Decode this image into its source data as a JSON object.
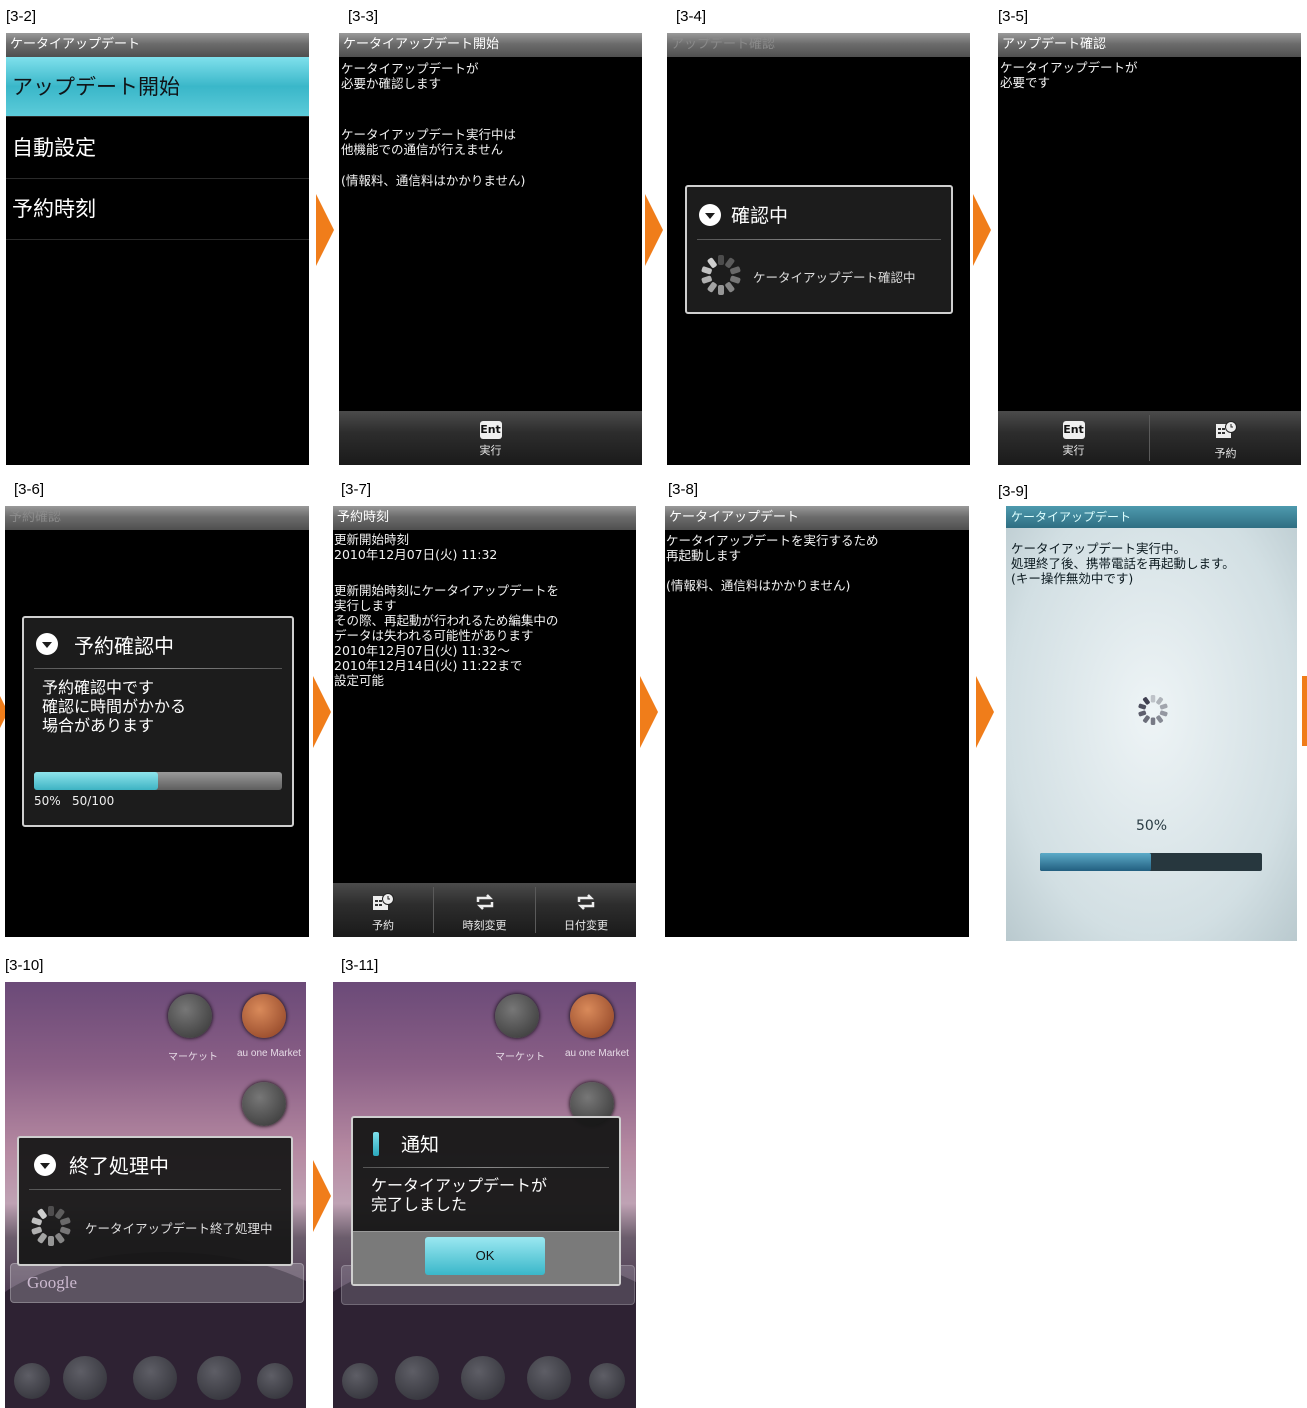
{
  "labels": {
    "s32": "[3-2]",
    "s33": "[3-3]",
    "s34": "[3-4]",
    "s35": "[3-5]",
    "s36": "[3-6]",
    "s37": "[3-7]",
    "s38": "[3-8]",
    "s39": "[3-9]",
    "s310": "[3-10]",
    "s311": "[3-11]"
  },
  "s32": {
    "title": "ケータイアップデート",
    "items": [
      "アップデート開始",
      "自動設定",
      "予約時刻"
    ]
  },
  "s33": {
    "title": "ケータイアップデート開始",
    "text1": "ケータイアップデートが\n必要か確認します",
    "text2": "ケータイアップデート実行中は\n他機能での通信が行えません",
    "text3": "(情報料、通信料はかかりません)",
    "btn_icon": "Ent",
    "btn": "実行"
  },
  "s34": {
    "title": "アップデート確認",
    "dialog_title": "確認中",
    "dialog_msg": "ケータイアップデート確認中"
  },
  "s35": {
    "title": "アップデート確認",
    "text": "ケータイアップデートが\n必要です",
    "btn_icon": "Ent",
    "btn1": "実行",
    "btn2": "予約"
  },
  "s36": {
    "title": "予約確認",
    "dialog_title": "予約確認中",
    "msg": "予約確認中です\n確認に時間がかかる\n場合があります",
    "progress": 0.5,
    "pct": "50%",
    "count": "50/100"
  },
  "s37": {
    "title": "予約時刻",
    "text1": "更新開始時刻\n2010年12月07日(火) 11:32",
    "text2": "更新開始時刻にケータイアップデートを\n実行します\nその際、再起動が行われるため編集中の\nデータは失われる可能性があります\n2010年12月07日(火) 11:32～\n2010年12月14日(火) 11:22まで\n設定可能",
    "btn1": "予約",
    "btn2": "時刻変更",
    "btn3": "日付変更"
  },
  "s38": {
    "title": "ケータイアップデート",
    "text1": "ケータイアップデートを実行するため\n再起動します",
    "text2": "(情報料、通信料はかかりません)"
  },
  "s39": {
    "title": "ケータイアップデート",
    "text": "ケータイアップデート実行中。\n処理終了後、携帯電話を再起動します。\n(キー操作無効中です)",
    "pct": "50%",
    "progress": 0.5
  },
  "s310": {
    "app1": "マーケット",
    "app2": "au one Market",
    "dialog_title": "終了処理中",
    "dialog_msg": "ケータイアップデート終了処理中",
    "search": "Google"
  },
  "s311": {
    "app1": "マーケット",
    "app2": "au one Market",
    "dialog_title": "通知",
    "dialog_msg": "ケータイアップデートが\n完了しました",
    "ok": "OK"
  },
  "colors": {
    "accent": "#f07d1a",
    "highlight": "#3ab7c9"
  },
  "icons": [
    "arrow-right-icon",
    "dialog-down-icon",
    "spinner-icon",
    "ent-key-icon",
    "calendar-clock-icon",
    "repeat-icon",
    "info-icon"
  ]
}
